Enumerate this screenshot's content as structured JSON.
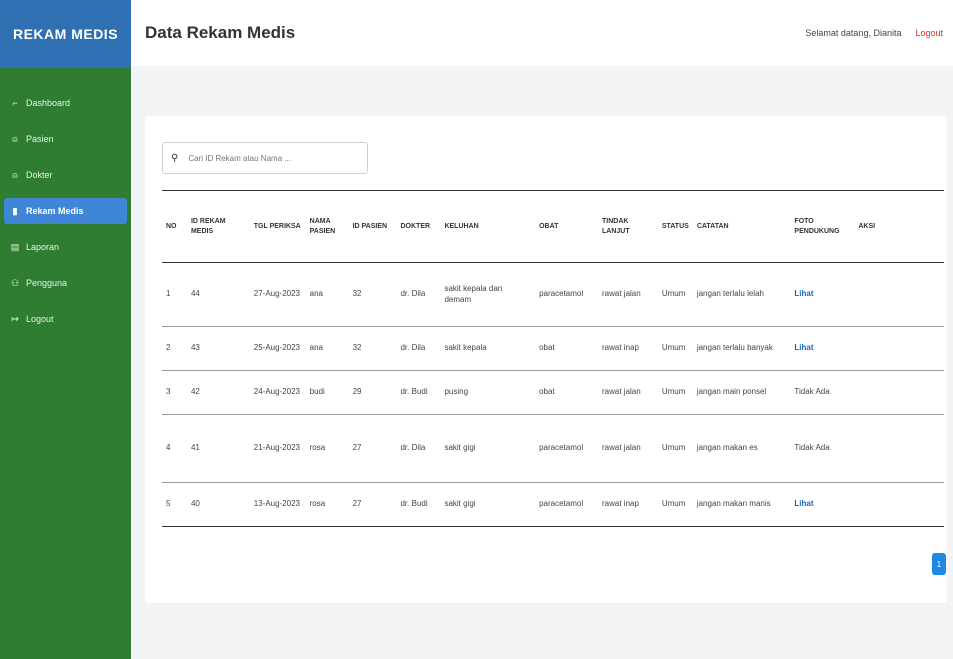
{
  "sidebar": {
    "brand": "REKAM MEDIS",
    "items": [
      {
        "label": "Dashboard",
        "icon": "chart-icon"
      },
      {
        "label": "Pasien",
        "icon": "user-icon"
      },
      {
        "label": "Dokter",
        "icon": "user-icon"
      },
      {
        "label": "Rekam Medis",
        "icon": "book-icon"
      },
      {
        "label": "Laporan",
        "icon": "file-icon"
      },
      {
        "label": "Pengguna",
        "icon": "users-icon"
      },
      {
        "label": "Logout",
        "icon": "logout-icon"
      }
    ]
  },
  "header": {
    "title": "Data Rekam Medis",
    "welcome": "Selamat datang, Dianita",
    "logout": "Logout"
  },
  "search": {
    "placeholder": "Cari ID Rekam atau Nama ..."
  },
  "table": {
    "headers": [
      "NO",
      "ID REKAM MEDIS",
      "TGL PERIKSA",
      "NAMA PASIEN",
      "ID PASIEN",
      "DOKTER",
      "KELUHAN",
      "OBAT",
      "TINDAK LANJUT",
      "STATUS",
      "CATATAN",
      "FOTO PENDUKUNG",
      "AKSI"
    ],
    "rows": [
      {
        "no": "1",
        "id": "44",
        "tgl": "27-Aug-2023",
        "nama": "ana",
        "id_pasien": "32",
        "dokter": "dr. Dila",
        "keluhan": "sakit kepala dan demam",
        "obat": "paracetamol",
        "tindak": "rawat jalan",
        "status": "Umum",
        "catatan": "jangan terlalu lelah",
        "foto": "Lihat"
      },
      {
        "no": "2",
        "id": "43",
        "tgl": "25-Aug-2023",
        "nama": "ana",
        "id_pasien": "32",
        "dokter": "dr. Dila",
        "keluhan": "sakit kepala",
        "obat": "obat",
        "tindak": "rawat inap",
        "status": "Umum",
        "catatan": "jangan terlalu banyak",
        "foto": "Lihat"
      },
      {
        "no": "3",
        "id": "42",
        "tgl": "24-Aug-2023",
        "nama": "budi",
        "id_pasien": "29",
        "dokter": "dr. Budi",
        "keluhan": "pusing",
        "obat": "obat",
        "tindak": "rawat jalan",
        "status": "Umum",
        "catatan": "jangan main ponsel",
        "foto": "Tidak Ada"
      },
      {
        "no": "4",
        "id": "41",
        "tgl": "21-Aug-2023",
        "nama": "rosa",
        "id_pasien": "27",
        "dokter": "dr. Dila",
        "keluhan": "sakit gigi",
        "obat": "paracetamol",
        "tindak": "rawat jalan",
        "status": "Umum",
        "catatan": "jangan makan es",
        "foto": "Tidak Ada"
      },
      {
        "no": "5",
        "id": "40",
        "tgl": "13-Aug-2023",
        "nama": "rosa",
        "id_pasien": "27",
        "dokter": "dr. Budi",
        "keluhan": "sakit gigi",
        "obat": "paracetamol",
        "tindak": "rawat inap",
        "status": "Umum",
        "catatan": "jangan makan manis",
        "foto": "Lihat"
      }
    ]
  },
  "pagination": {
    "current": "1"
  },
  "colors": {
    "sidebar": "#2e7d32",
    "brand": "#2f70b3",
    "active": "#3f87d6",
    "logout": "#d32f2f"
  }
}
